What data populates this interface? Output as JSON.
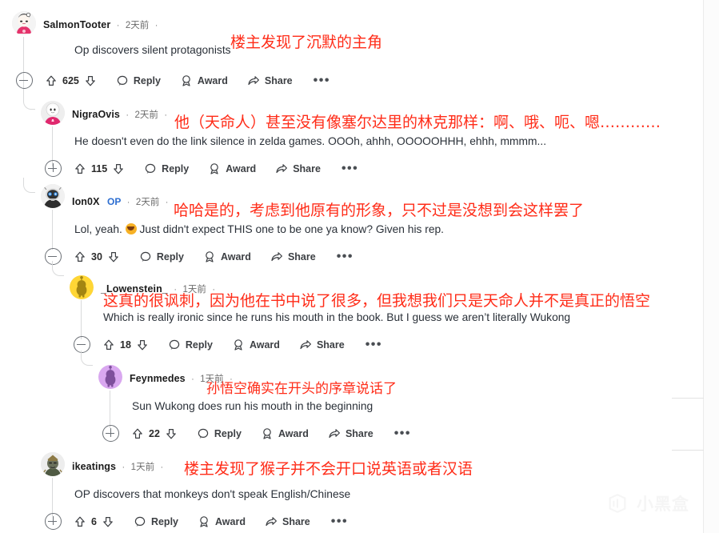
{
  "watermark": {
    "text": "小黑盒",
    "icon": "xiaoheihe-logo-icon"
  },
  "labels": {
    "reply": "Reply",
    "award": "Award",
    "share": "Share",
    "more": "•••",
    "op": "OP",
    "separator": "·"
  },
  "colors": {
    "overlay_red": "#ff2c18",
    "body_text": "#2a3038",
    "username": "#1b1b1b",
    "op_blue": "#2d6ed1",
    "timestamp": "#6b6b6b",
    "thread_line": "#d9dadb"
  },
  "comments": [
    {
      "id": "salmontooter",
      "username": "SalmonTooter",
      "is_op": false,
      "timestamp": "2天前",
      "overlay_cn": "楼主发现了沉默的主角",
      "body_en": "Op discovers silent protagonists",
      "score": "625",
      "collapse_state": "minus",
      "depth": 0,
      "avatar": "salmontooter-avatar"
    },
    {
      "id": "nigraovis",
      "username": "NigraOvis",
      "is_op": false,
      "timestamp": "2天前",
      "overlay_cn": "他（天命人）甚至没有像塞尔达里的林克那样：啊、哦、呃、嗯…………",
      "body_en": "He doesn't even do the link silence in zelda games. OOOh, ahhh, OOOOOHHH, ehhh, mmmm...",
      "score": "115",
      "collapse_state": "plus",
      "depth": 1,
      "avatar": "nigraovis-avatar"
    },
    {
      "id": "ion0x",
      "username": "Ion0X",
      "is_op": true,
      "timestamp": "2天前",
      "overlay_cn": "哈哈是的，考虑到他原有的形象，只不过是没想到会这样罢了",
      "body_en": "Lol, yeah.  Just didn't expect THIS one to be one ya know? Given his rep.",
      "body_en_pre": "Lol, yeah.",
      "body_en_post": "Just didn't expect THIS one to be one ya know? Given his rep.",
      "has_emoji": true,
      "emoji": "grinning-face-emoji",
      "score": "30",
      "collapse_state": "minus",
      "depth": 1,
      "avatar": "ion0x-avatar"
    },
    {
      "id": "lowenstein",
      "username": "_Lowenstein_",
      "is_op": false,
      "timestamp": "1天前",
      "overlay_cn": "这真的很讽刺，因为他在书中说了很多，但我想我们只是天命人并不是真正的悟空",
      "body_en": "Which is really ironic since he runs his mouth in the book. But I guess we aren’t literally Wukong",
      "score": "18",
      "collapse_state": "minus",
      "depth": 2,
      "avatar": "lowenstein-avatar"
    },
    {
      "id": "feynmedes",
      "username": "Feynmedes",
      "is_op": false,
      "timestamp": "1天前",
      "overlay_cn": "孙悟空确实在开头的序章说话了",
      "body_en": "Sun Wukong does run his mouth in the beginning",
      "score": "22",
      "collapse_state": "plus",
      "depth": 3,
      "avatar": "feynmedes-avatar"
    },
    {
      "id": "ikeatings",
      "username": "ikeatings",
      "is_op": false,
      "timestamp": "1天前",
      "overlay_cn": "楼主发现了猴子并不会开口说英语或者汉语",
      "body_en": "OP discovers that monkeys don't speak English/Chinese",
      "score": "6",
      "collapse_state": "plus",
      "depth": 0,
      "avatar": "ikeatings-avatar"
    }
  ]
}
